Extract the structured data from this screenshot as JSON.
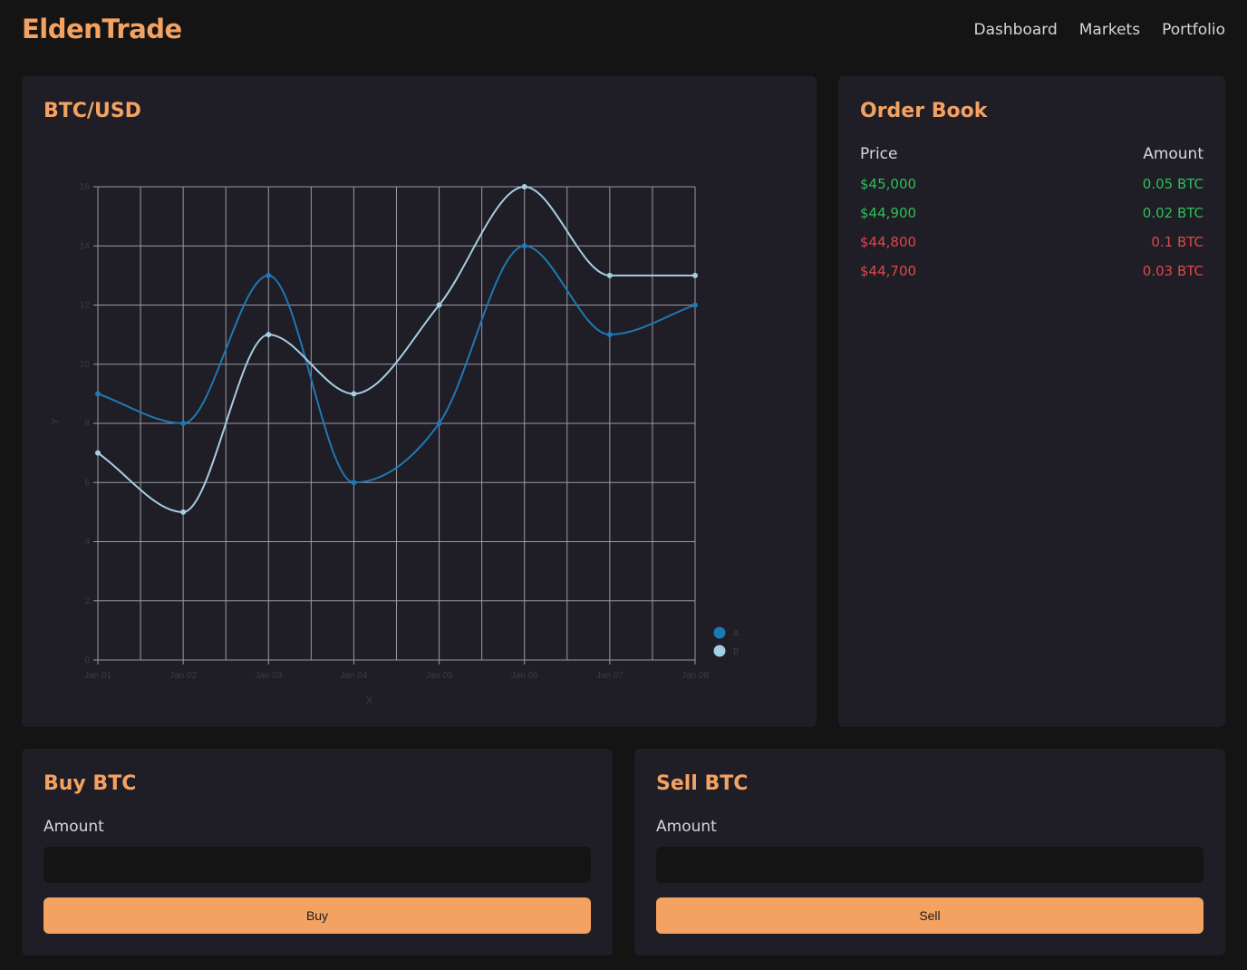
{
  "brand": "EldenTrade",
  "nav": [
    "Dashboard",
    "Markets",
    "Portfolio"
  ],
  "chart_card": {
    "title": "BTC/USD"
  },
  "chart_data": {
    "type": "line",
    "x": [
      "Jan 01",
      "Jan 02",
      "Jan 03",
      "Jan 04",
      "Jan 05",
      "Jan 06",
      "Jan 07",
      "Jan 08"
    ],
    "series": [
      {
        "name": "A",
        "color": "#1f78b4",
        "values": [
          9,
          8,
          13,
          6,
          8,
          14,
          11,
          12
        ]
      },
      {
        "name": "B",
        "color": "#a6cee3",
        "values": [
          7,
          5,
          11,
          9,
          12,
          16,
          13,
          13
        ]
      }
    ],
    "title": "",
    "xlabel": "X",
    "ylabel": "Y",
    "ylim": [
      0,
      16
    ],
    "yticks": [
      0,
      2,
      4,
      6,
      8,
      10,
      12,
      14,
      16
    ],
    "grid": true,
    "legend": "bottom-right"
  },
  "order_book": {
    "title": "Order Book",
    "headers": {
      "price": "Price",
      "amount": "Amount"
    },
    "rows": [
      {
        "price": "$45,000",
        "amount": "0.05 BTC",
        "side": "buy"
      },
      {
        "price": "$44,900",
        "amount": "0.02 BTC",
        "side": "buy"
      },
      {
        "price": "$44,800",
        "amount": "0.1 BTC",
        "side": "sell"
      },
      {
        "price": "$44,700",
        "amount": "0.03 BTC",
        "side": "sell"
      }
    ]
  },
  "buy": {
    "title": "Buy BTC",
    "label": "Amount",
    "value": "",
    "button": "Buy"
  },
  "sell": {
    "title": "Sell BTC",
    "label": "Amount",
    "value": "",
    "button": "Sell"
  }
}
